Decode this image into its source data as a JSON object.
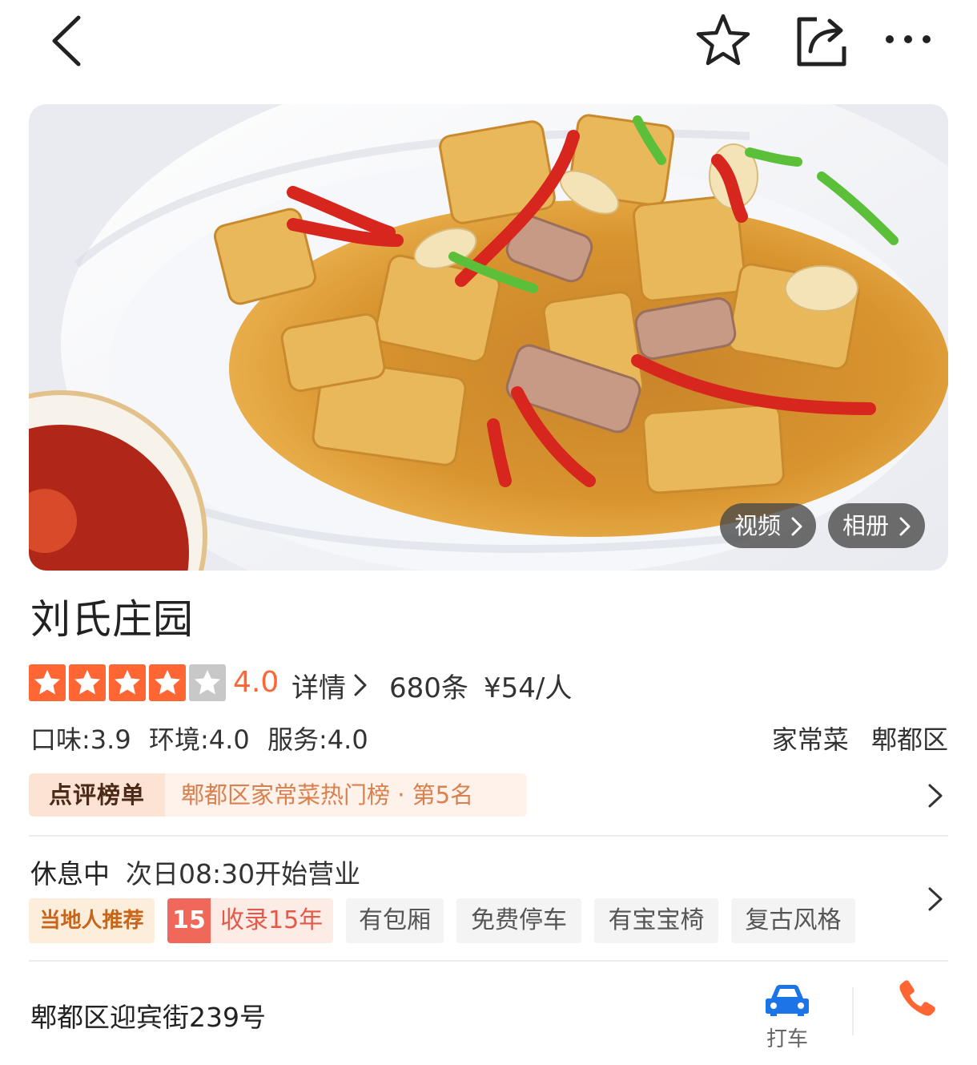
{
  "topbar": {
    "back_icon": "chevron-left-icon",
    "favorite_icon": "star-outline-icon",
    "share_icon": "share-icon",
    "more_icon": "more-horizontal-icon"
  },
  "hero": {
    "video_label": "视频",
    "album_label": "相册"
  },
  "shop": {
    "name": "刘氏庄园",
    "rating": 4.0,
    "rating_text": "4.0",
    "stars_total": 5,
    "detail_label": "详情",
    "review_count": "680条",
    "price": "¥54/人",
    "taste": "口味:3.9",
    "environment": "环境:4.0",
    "service": "服务:4.0",
    "category": "家常菜",
    "district": "郫都区"
  },
  "ranking": {
    "badge": "点评榜单",
    "text": "郫都区家常菜热门榜 · 第5名"
  },
  "hours": {
    "status": "休息中",
    "next": "次日08:30开始营业"
  },
  "tags": {
    "local": "当地人推荐",
    "years_num": "15",
    "years_text": "收录15年",
    "items": [
      "有包厢",
      "免费停车",
      "有宝宝椅",
      "复古风格"
    ]
  },
  "address": {
    "text": "郫都区迎宾街239号",
    "taxi_label": "打车"
  },
  "colors": {
    "accent": "#ff6633",
    "star_empty": "#c8c8c8",
    "rank_bg": "#fef2ea",
    "tag_bg": "#f4f4f4"
  }
}
